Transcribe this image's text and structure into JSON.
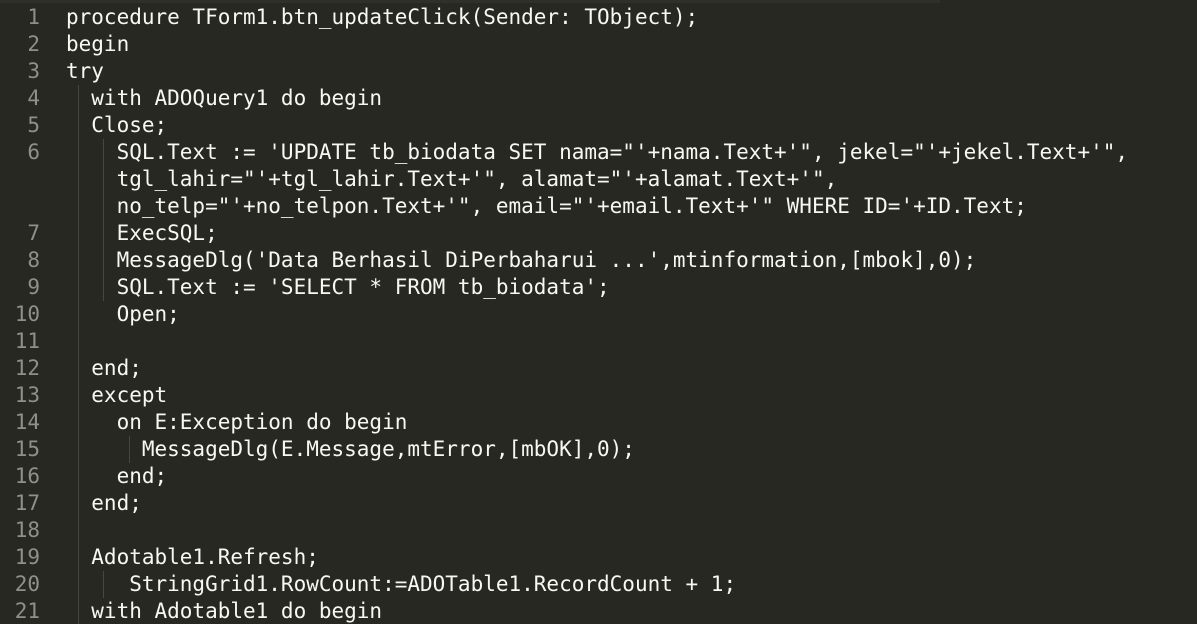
{
  "editor": {
    "gutter": [
      "1",
      "2",
      "3",
      "4",
      "5",
      "6",
      "",
      "",
      "7",
      "8",
      "9",
      "10",
      "11",
      "12",
      "13",
      "14",
      "15",
      "16",
      "17",
      "18",
      "19",
      "20",
      "21"
    ],
    "lines": [
      "procedure TForm1.btn_updateClick(Sender: TObject);",
      "begin",
      "try",
      "  with ADOQuery1 do begin",
      "  Close;",
      "    SQL.Text := 'UPDATE tb_biodata SET nama=\"'+nama.Text+'\", jekel=\"'+jekel.Text+'\",",
      "    tgl_lahir=\"'+tgl_lahir.Text+'\", alamat=\"'+alamat.Text+'\",",
      "    no_telp=\"'+no_telpon.Text+'\", email=\"'+email.Text+'\" WHERE ID='+ID.Text;",
      "    ExecSQL;",
      "    MessageDlg('Data Berhasil DiPerbaharui ...',mtinformation,[mbok],0);",
      "    SQL.Text := 'SELECT * FROM tb_biodata';",
      "    Open;",
      "",
      "  end;",
      "  except",
      "    on E:Exception do begin",
      "      MessageDlg(E.Message,mtError,[mbOK],0);",
      "    end;",
      "  end;",
      "",
      "  Adotable1.Refresh;",
      "     StringGrid1.RowCount:=ADOTable1.RecordCount + 1;",
      "  with Adotable1 do begin"
    ]
  }
}
